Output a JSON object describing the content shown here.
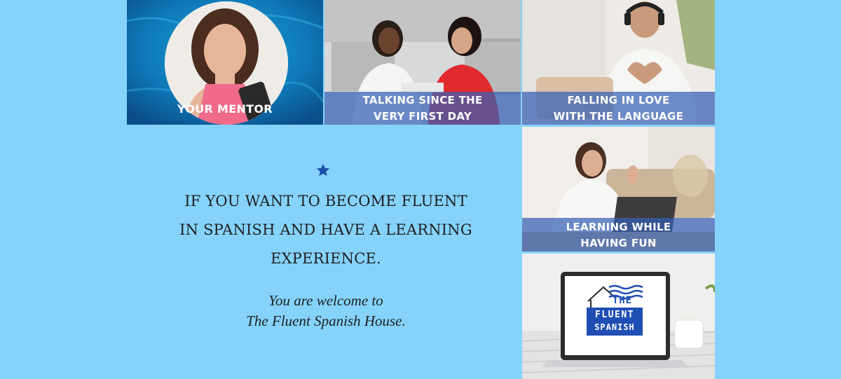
{
  "tiles": {
    "mentor": {
      "label": "YOUR MENTOR"
    },
    "talking": {
      "line1": "TALKING SINCE THE",
      "line2": "VERY FIRST DAY"
    },
    "falling": {
      "line1": "FALLING IN LOVE",
      "line2": "WITH THE LANGUAGE"
    },
    "learning": {
      "line1": "LEARNING WHILE",
      "line2": "HAVING FUN"
    },
    "laptop": {
      "logo_line1": "THE",
      "logo_line2": "FLUENT",
      "logo_line3": "SPANISH"
    }
  },
  "message": {
    "headline_line1": "IF YOU WANT TO BECOME FLUENT",
    "headline_line2": "IN SPANISH AND HAVE A LEARNING",
    "headline_line3": "EXPERIENCE.",
    "welcome_line1": "You are welcome to",
    "welcome_line2": "The Fluent Spanish House."
  },
  "colors": {
    "background": "#85d3fb",
    "banner": "#3660b4",
    "star": "#1a4fa8",
    "logo_blue": "#1f4fb4"
  },
  "icons": [
    "star-icon",
    "house-logo-icon"
  ]
}
